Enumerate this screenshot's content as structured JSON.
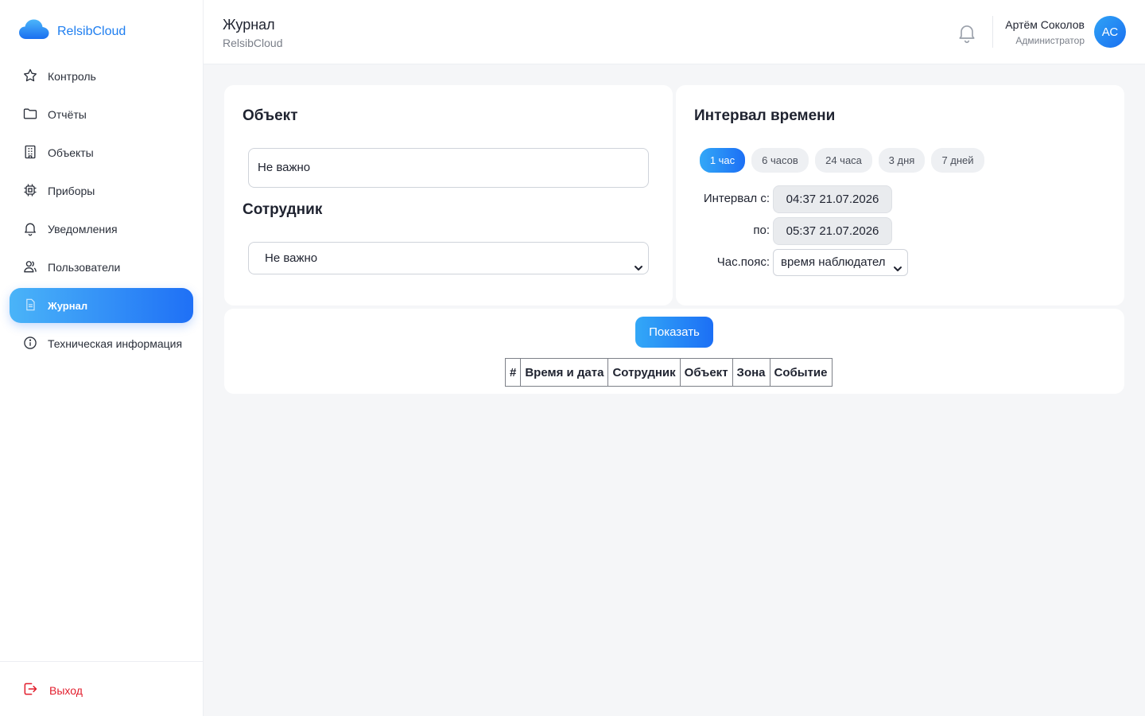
{
  "brand": {
    "name": "RelsibCloud",
    "logo_icon": "cloud-icon",
    "color": "#1e7ef0"
  },
  "sidebar": {
    "items": [
      {
        "label": "Контроль",
        "icon": "star-icon",
        "active": false
      },
      {
        "label": "Отчёты",
        "icon": "folder-icon",
        "active": false
      },
      {
        "label": "Объекты",
        "icon": "building-icon",
        "active": false
      },
      {
        "label": "Приборы",
        "icon": "chip-icon",
        "active": false
      },
      {
        "label": "Уведомления",
        "icon": "bell-icon",
        "active": false
      },
      {
        "label": "Пользователи",
        "icon": "users-icon",
        "active": false
      },
      {
        "label": "Журнал",
        "icon": "document-icon",
        "active": true
      },
      {
        "label": "Техническая информация",
        "icon": "info-icon",
        "active": false
      }
    ],
    "logout_label": "Выход"
  },
  "header": {
    "title": "Журнал",
    "subtitle": "RelsibCloud",
    "user_name": "Артём Соколов",
    "user_role": "Администратор",
    "avatar_initials": "АС"
  },
  "object_card": {
    "title": "Объект",
    "object_value": "Не важно",
    "employee_title": "Сотрудник",
    "employee_value": "Не важно"
  },
  "interval_card": {
    "title": "Интервал времени",
    "presets": [
      {
        "label": "1 час",
        "active": true
      },
      {
        "label": "6 часов",
        "active": false
      },
      {
        "label": "24 часа",
        "active": false
      },
      {
        "label": "3 дня",
        "active": false
      },
      {
        "label": "7 дней",
        "active": false
      }
    ],
    "from_label": "Интервал с:",
    "from_value": "04:37 21.07.2026",
    "to_label": "по:",
    "to_value": "05:37 21.07.2026",
    "tz_label": "Час.пояс:",
    "tz_value": "время наблюдател"
  },
  "actions": {
    "show_label": "Показать"
  },
  "table": {
    "columns": [
      "#",
      "Время и дата",
      "Сотрудник",
      "Объект",
      "Зона",
      "Событие"
    ]
  },
  "colors": {
    "accent_start": "#4ab4f8",
    "accent_end": "#1f70f6",
    "logout": "#e21d2c"
  }
}
